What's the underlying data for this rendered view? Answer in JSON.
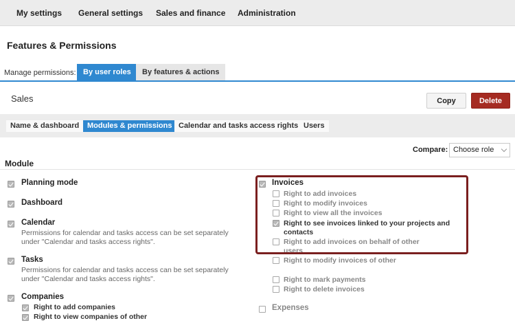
{
  "topnav": {
    "items": [
      "My settings",
      "General settings",
      "Sales and finance",
      "Administration"
    ]
  },
  "page_title": "Features & Permissions",
  "manage": {
    "label": "Manage permissions:",
    "tabs": [
      "By user roles",
      "By features & actions"
    ]
  },
  "role": {
    "name": "Sales",
    "copy_label": "Copy",
    "delete_label": "Delete"
  },
  "subtabs": [
    "Name & dashboard",
    "Modules & permissions",
    "Calendar and tasks access rights",
    "Users"
  ],
  "compare": {
    "label": "Compare:",
    "value": "Choose role"
  },
  "module_heading": "Module",
  "left_modules": {
    "planning": "Planning mode",
    "dashboard": "Dashboard",
    "calendar": "Calendar",
    "calendar_desc_1": "Permissions for calendar and tasks access can be set separately",
    "calendar_desc_2": "under \"Calendar and tasks access rights\".",
    "tasks": "Tasks",
    "tasks_desc_1": "Permissions for calendar and tasks access can be set separately",
    "tasks_desc_2": "under \"Calendar and tasks access rights\".",
    "companies": "Companies",
    "companies_add": "Right to add companies",
    "companies_view": "Right to view companies of other"
  },
  "invoices": {
    "title": "Invoices",
    "add": "Right to add invoices",
    "modify": "Right to modify invoices",
    "view_all": "Right to view all the invoices",
    "see_linked_1": "Right to see invoices linked to your projects and",
    "see_linked_2": "contacts",
    "behalf_1": "Right to add invoices on behalf of other",
    "behalf_2": "users",
    "modify_other": "Right to modify invoices of other",
    "mark_payments": "Right to mark payments",
    "delete": "Right to delete invoices"
  },
  "expenses": "Expenses"
}
